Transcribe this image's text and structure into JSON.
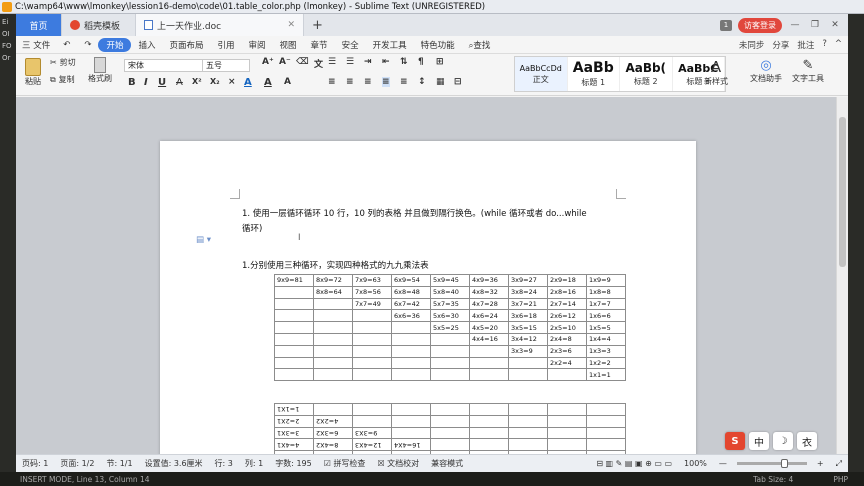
{
  "outer": {
    "title": "C:\\wamp64\\www\\lmonkey\\lession16-demo\\code\\01.table_color.php (lmonkey) - Sublime Text (UNREGISTERED)",
    "left_labels": [
      "Ei",
      "OI",
      "FO",
      "Or"
    ],
    "status_left": "INSERT MODE, Line 13, Column 14",
    "status_tab": "Tab Size: 4",
    "status_lang": "PHP"
  },
  "tabs": {
    "home": "首页",
    "template": "稻壳模板",
    "doc": "上一天作业.doc",
    "count": "1",
    "login": "访客登录"
  },
  "menu": {
    "file": "三 文件",
    "items": [
      "开始",
      "插入",
      "页面布局",
      "引用",
      "审阅",
      "视图",
      "章节",
      "安全",
      "开发工具",
      "特色功能"
    ],
    "search": "查找",
    "right": [
      "未同步",
      "分享",
      "批注"
    ]
  },
  "ribbon": {
    "paste": "粘贴",
    "cut": "剪切",
    "copy": "复制",
    "format_painter": "格式刷",
    "font_name": "宋体",
    "font_size": "五号",
    "styles": [
      {
        "preview": "AaBbCcDd",
        "name": "正文"
      },
      {
        "preview": "AaBb",
        "name": "标题 1"
      },
      {
        "preview": "AaBb(",
        "name": "标题 2"
      },
      {
        "preview": "AaBbC",
        "name": "标题 3"
      }
    ],
    "new_style": "新样式",
    "doc_assistant": "文档助手",
    "text_tools": "文字工具"
  },
  "document": {
    "para1_line1": "1.  使用一层循环循环 10 行，10 列的表格  并且做到隔行换色。(while 循环或者 do...while",
    "para1_line2": "循环)",
    "para2": "1.分别使用三种循环，实现四种格式的九九乘法表",
    "table1": [
      [
        "9x9=81",
        "8x9=72",
        "7x9=63",
        "6x9=54",
        "5x9=45",
        "4x9=36",
        "3x9=27",
        "2x9=18",
        "1x9=9"
      ],
      [
        "",
        "8x8=64",
        "7x8=56",
        "6x8=48",
        "5x8=40",
        "4x8=32",
        "3x8=24",
        "2x8=16",
        "1x8=8"
      ],
      [
        "",
        "",
        "7x7=49",
        "6x7=42",
        "5x7=35",
        "4x7=28",
        "3x7=21",
        "2x7=14",
        "1x7=7"
      ],
      [
        "",
        "",
        "",
        "6x6=36",
        "5x6=30",
        "4x6=24",
        "3x6=18",
        "2x6=12",
        "1x6=6"
      ],
      [
        "",
        "",
        "",
        "",
        "5x5=25",
        "4x5=20",
        "3x5=15",
        "2x5=10",
        "1x5=5"
      ],
      [
        "",
        "",
        "",
        "",
        "",
        "4x4=16",
        "3x4=12",
        "2x4=8",
        "1x4=4"
      ],
      [
        "",
        "",
        "",
        "",
        "",
        "",
        "3x3=9",
        "2x3=6",
        "1x3=3"
      ],
      [
        "",
        "",
        "",
        "",
        "",
        "",
        "",
        "2x2=4",
        "1x2=2"
      ],
      [
        "",
        "",
        "",
        "",
        "",
        "",
        "",
        "",
        "1x1=1"
      ]
    ],
    "table2": [
      [
        "1=1X1",
        "",
        "",
        "",
        "",
        "",
        "",
        "",
        ""
      ],
      [
        "2=2X1",
        "4=2X2",
        "",
        "",
        "",
        "",
        "",
        "",
        ""
      ],
      [
        "3=3X1",
        "6=3X2",
        "9=3X3",
        "",
        "",
        "",
        "",
        "",
        ""
      ],
      [
        "4=4X1",
        "8=4X2",
        "12=4X3",
        "16=4X4",
        "",
        "",
        "",
        "",
        ""
      ],
      [
        "5=5X1",
        "10=5X2",
        "15=5X3",
        "20=5X4",
        "25=5X5",
        "",
        "",
        "",
        ""
      ]
    ]
  },
  "status": {
    "page": "页码: 1",
    "pages": "页面: 1/2",
    "section": "节: 1/1",
    "setting": "设置值: 3.6厘米",
    "row": "行: 3",
    "col": "列: 1",
    "words": "字数: 195",
    "spell": "拼写检查",
    "proof": "文档校对",
    "compat": "兼容模式",
    "zoom": "100%"
  },
  "side_tools": [
    "S",
    "中",
    "☽",
    "衣"
  ]
}
